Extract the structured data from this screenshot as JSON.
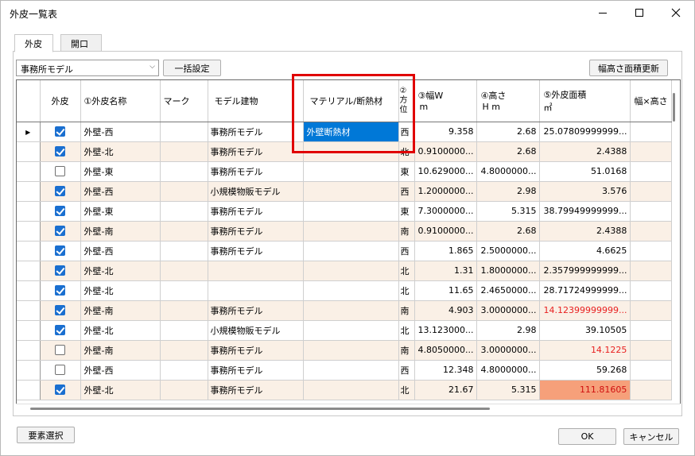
{
  "window": {
    "title": "外皮一覧表"
  },
  "tabs": [
    {
      "label": "外皮"
    },
    {
      "label": "開口"
    }
  ],
  "toolbar": {
    "model_select": "事務所モデル",
    "bulk_button": "一括設定",
    "update_button": "幅高さ面積更新"
  },
  "columns": {
    "gaihi": "外皮",
    "name": "①外皮名称",
    "mark": "マーク",
    "model": "モデル建物",
    "material": "マテリアル/断熱材",
    "dir1": "②",
    "dir2": "方",
    "dir3": "位",
    "w1": "③幅W",
    "w2": "m",
    "h1": "④高さ",
    "h2": "H m",
    "area": "⑤外皮面積",
    "area_unit": "㎡",
    "wh": "幅×高さ"
  },
  "rows": [
    {
      "checked": true,
      "name": "外壁-西",
      "mark": "",
      "model": "事務所モデル",
      "material": "外壁断熱材",
      "dir": "西",
      "w": "9.358",
      "h": "2.68",
      "area": "25.07809999999..."
    },
    {
      "checked": true,
      "name": "外壁-北",
      "mark": "",
      "model": "事務所モデル",
      "material": "",
      "dir": "北",
      "w": "0.9100000...",
      "h": "2.68",
      "area": "2.4388"
    },
    {
      "checked": false,
      "name": "外壁-東",
      "mark": "",
      "model": "事務所モデル",
      "material": "",
      "dir": "東",
      "w": "10.629000...",
      "h": "4.8000000...",
      "area": "51.0168"
    },
    {
      "checked": true,
      "name": "外壁-西",
      "mark": "",
      "model": "小規模物販モデル",
      "material": "",
      "dir": "西",
      "w": "1.2000000...",
      "h": "2.98",
      "area": "3.576"
    },
    {
      "checked": true,
      "name": "外壁-東",
      "mark": "",
      "model": "事務所モデル",
      "material": "",
      "dir": "東",
      "w": "7.3000000...",
      "h": "5.315",
      "area": "38.79949999999..."
    },
    {
      "checked": true,
      "name": "外壁-南",
      "mark": "",
      "model": "事務所モデル",
      "material": "",
      "dir": "南",
      "w": "0.9100000...",
      "h": "2.68",
      "area": "2.4388"
    },
    {
      "checked": true,
      "name": "外壁-西",
      "mark": "",
      "model": "事務所モデル",
      "material": "",
      "dir": "西",
      "w": "1.865",
      "h": "2.5000000...",
      "area": "4.6625"
    },
    {
      "checked": true,
      "name": "外壁-北",
      "mark": "",
      "model": "",
      "material": "",
      "dir": "北",
      "w": "1.31",
      "h": "1.8000000...",
      "area": "2.357999999999..."
    },
    {
      "checked": true,
      "name": "外壁-北",
      "mark": "",
      "model": "",
      "material": "",
      "dir": "北",
      "w": "11.65",
      "h": "2.4650000...",
      "area": "28.71724999999..."
    },
    {
      "checked": true,
      "name": "外壁-南",
      "mark": "",
      "model": "事務所モデル",
      "material": "",
      "dir": "南",
      "w": "4.903",
      "h": "3.0000000...",
      "area": "14.12399999999...",
      "area_red": true
    },
    {
      "checked": true,
      "name": "外壁-北",
      "mark": "",
      "model": "小規模物販モデル",
      "material": "",
      "dir": "北",
      "w": "13.123000...",
      "h": "2.98",
      "area": "39.10505"
    },
    {
      "checked": false,
      "name": "外壁-南",
      "mark": "",
      "model": "事務所モデル",
      "material": "",
      "dir": "南",
      "w": "4.8050000...",
      "h": "3.0000000...",
      "area": "14.1225",
      "area_red": true
    },
    {
      "checked": false,
      "name": "外壁-西",
      "mark": "",
      "model": "事務所モデル",
      "material": "",
      "dir": "西",
      "w": "12.348",
      "h": "4.8000000...",
      "area": "59.268"
    },
    {
      "checked": true,
      "name": "外壁-北",
      "mark": "",
      "model": "事務所モデル",
      "material": "",
      "dir": "北",
      "w": "21.67",
      "h": "5.315",
      "area": "111.81605",
      "area_hl": true
    }
  ],
  "footer": {
    "select_elements": "要素選択",
    "ok": "OK",
    "cancel": "キャンセル"
  }
}
